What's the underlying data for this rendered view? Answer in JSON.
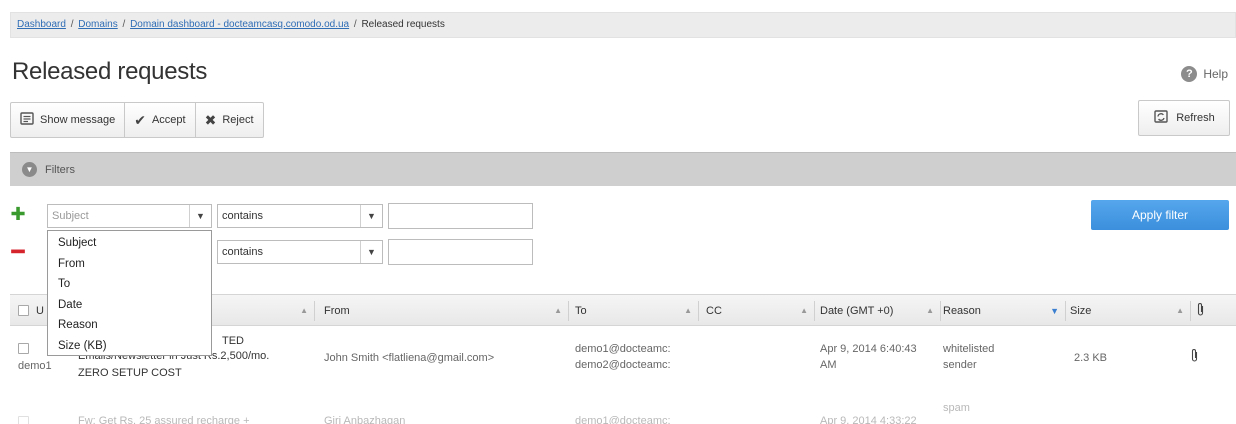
{
  "breadcrumb": {
    "dashboard": "Dashboard",
    "domains": "Domains",
    "domain_dashboard": "Domain dashboard - docteamcasq.comodo.od.ua",
    "current": "Released requests",
    "sep": "/"
  },
  "page_title": "Released requests",
  "help_label": "Help",
  "toolbar": {
    "show_message": "Show message",
    "accept": "Accept",
    "reject": "Reject",
    "refresh": "Refresh"
  },
  "filters": {
    "title": "Filters",
    "row1": {
      "field_placeholder": "Subject",
      "operator": "contains",
      "value": ""
    },
    "row2": {
      "operator": "contains",
      "value": ""
    },
    "apply": "Apply filter",
    "field_options": [
      "Subject",
      "From",
      "To",
      "Date",
      "Reason",
      "Size (KB)"
    ]
  },
  "grid": {
    "columns": {
      "user": "U",
      "from": "From",
      "to": "To",
      "cc": "CC",
      "date": "Date (GMT +0)",
      "reason": "Reason",
      "size": "Size"
    },
    "rows": [
      {
        "user": "demo1",
        "subject_line1": "TED",
        "subject_line2": "Emails/Newsletter in Just Rs.2,500/mo.",
        "subject_line3": "ZERO SETUP COST",
        "from": "John Smith <flatliena@gmail.com>",
        "to_line1": "demo1@docteamc:",
        "to_line2": "demo2@docteamc:",
        "date_line1": "Apr 9, 2014 6:40:43",
        "date_line2": "AM",
        "reason_line1": "whitelisted",
        "reason_line2": "sender",
        "size": "2.3 KB"
      },
      {
        "subject_line1": "Fw: Get Rs. 25 assured recharge +",
        "from": "Giri Anbazhagan",
        "to_line1": "demo1@docteamc:",
        "date_line1": "Apr 9, 2014 4:33:22",
        "reason_line1": "spam"
      }
    ]
  },
  "colors": {
    "accent": "#3b8fdc",
    "link": "#2f6db5",
    "add": "#3a9a2e",
    "remove": "#d5242b"
  }
}
